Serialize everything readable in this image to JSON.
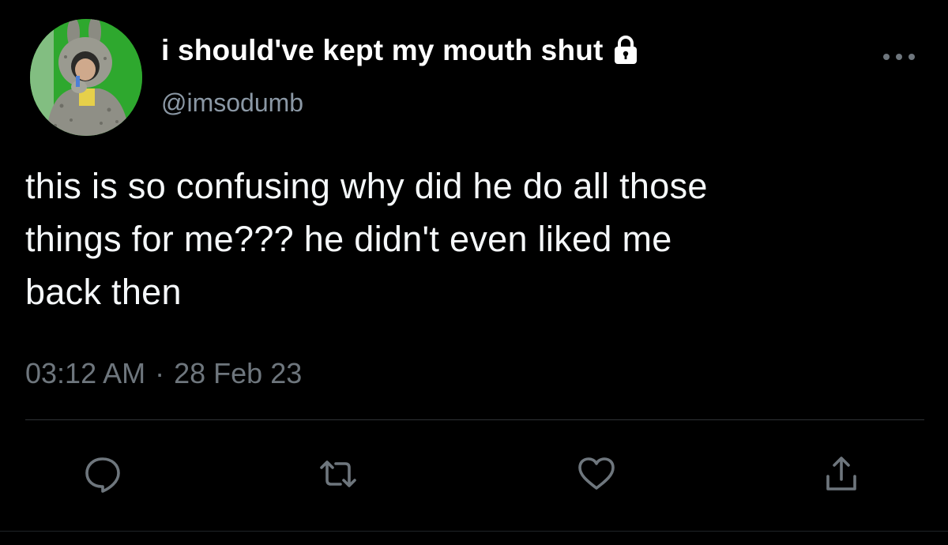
{
  "user": {
    "display_name": "i should've kept my mouth shut",
    "handle": "@imsodumb",
    "protected_icon": "lock-icon",
    "avatar_icon": "avatar"
  },
  "tweet": {
    "text": "this is so confusing why did he do all those\nthings for me??? he didn't even liked me\nback then",
    "time": "03:12 AM",
    "separator": "·",
    "date": "28 Feb 23"
  },
  "actions": {
    "icons": [
      "reply-icon",
      "retweet-icon",
      "like-icon",
      "share-icon"
    ]
  },
  "colors": {
    "background": "#000000",
    "text": "#f5f8fa",
    "secondary_text": "#8b98a5",
    "divider": "#2f3336"
  }
}
